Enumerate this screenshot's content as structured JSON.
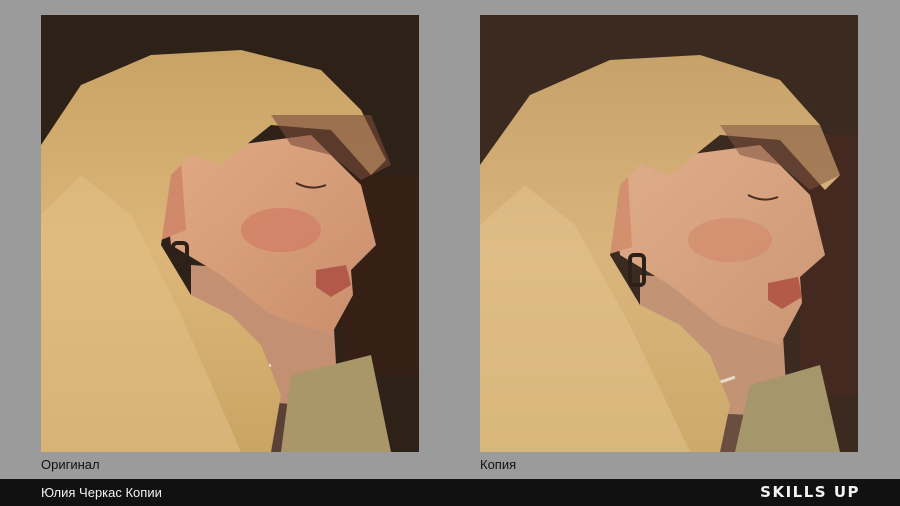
{
  "panels": {
    "original": {
      "label": "Оригинал"
    },
    "copy": {
      "label": "Копия"
    }
  },
  "footer": {
    "author": "Юлия Черкас Копии",
    "brand": "SKILLS UP"
  },
  "colors": {
    "page_background": "#9b9b9b",
    "footer_background": "#111111",
    "painting_background_original": "#2e2218",
    "painting_background_copy": "#3a2a20",
    "hair": "#d6b173",
    "skin": "#d9a27c",
    "cheek": "#cf8a6e",
    "lips": "#b55a4a"
  }
}
